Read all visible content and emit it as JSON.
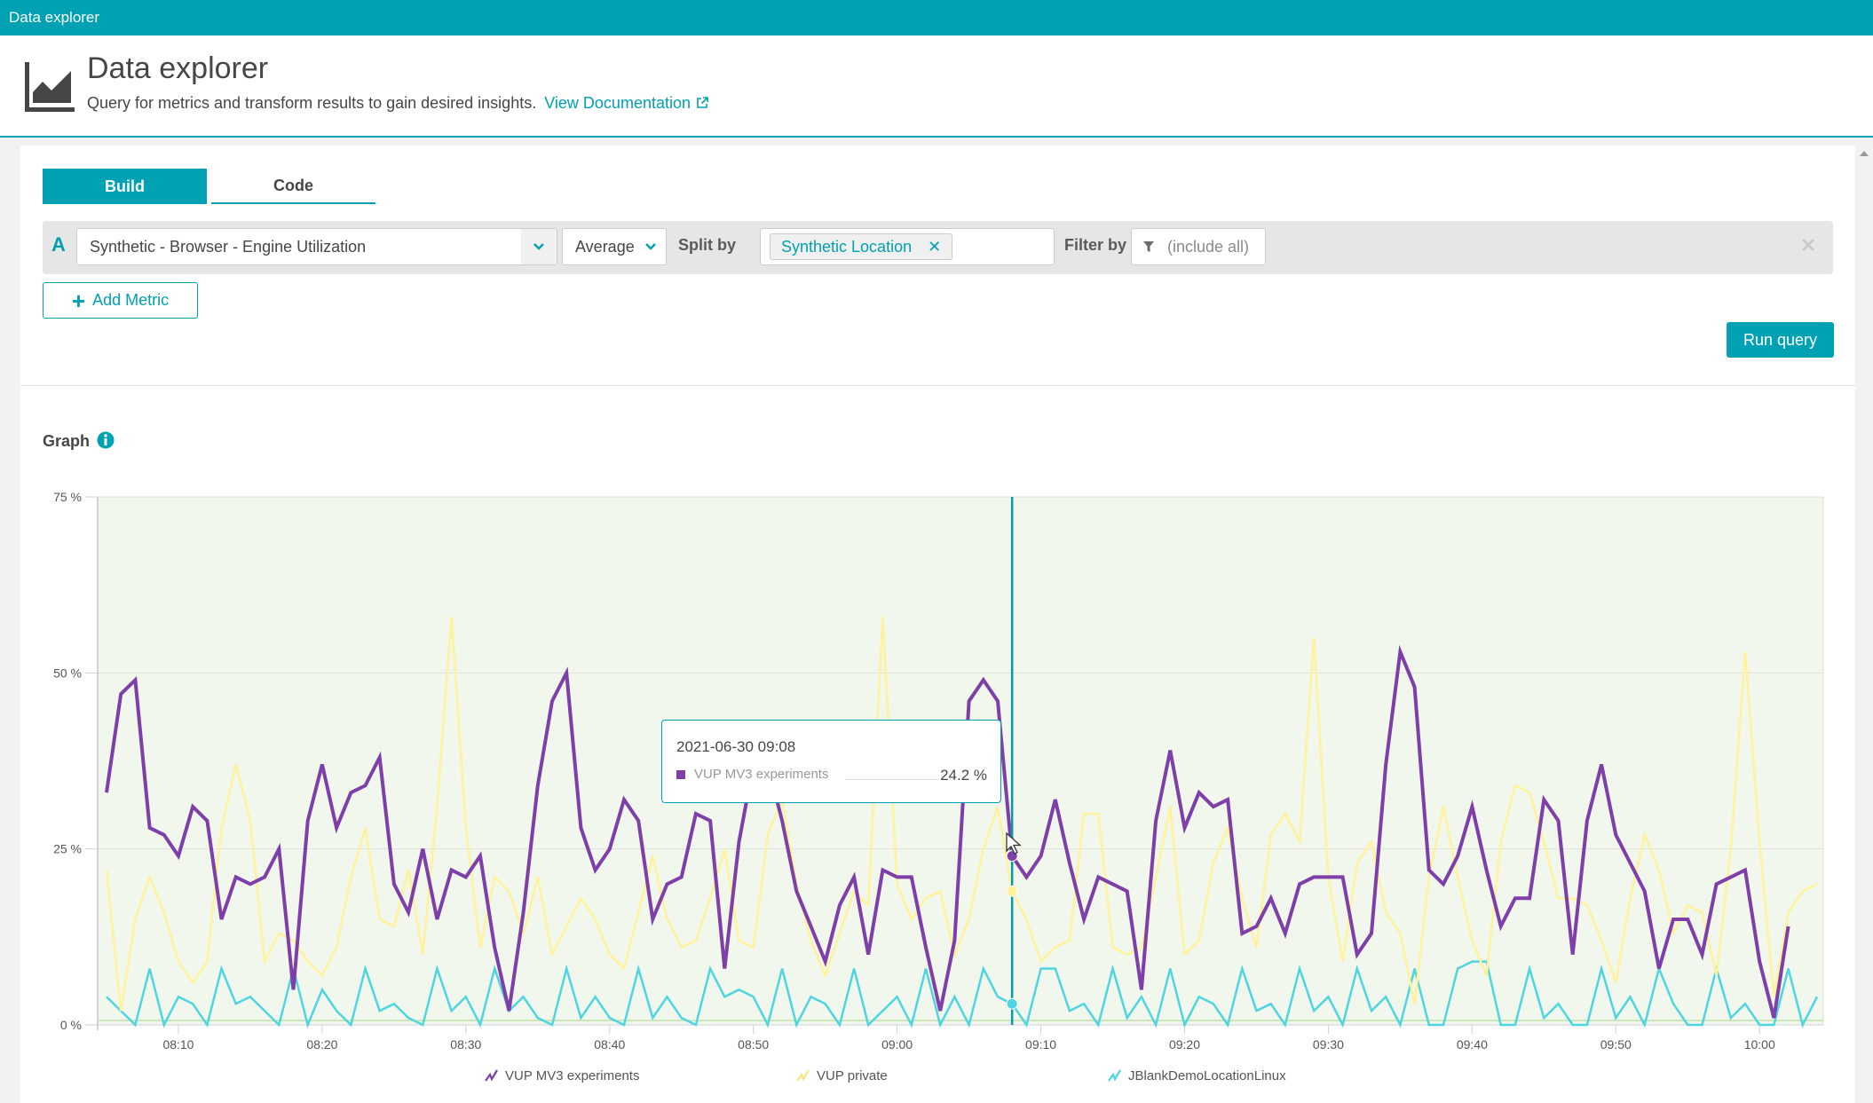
{
  "topbar": {
    "title": "Data explorer"
  },
  "header": {
    "title": "Data explorer",
    "subtitle": "Query for metrics and transform results to gain desired insights.",
    "doc_link": "View Documentation"
  },
  "tabs": [
    {
      "label": "Build",
      "active": true
    },
    {
      "label": "Code",
      "active": false
    }
  ],
  "query": {
    "letter": "A",
    "metric": "Synthetic - Browser - Engine Utilization",
    "aggregation": "Average",
    "split_by_label": "Split by",
    "split_by_chip": "Synthetic Location",
    "filter_by_label": "Filter by",
    "filter_placeholder": "(include all)"
  },
  "buttons": {
    "add_metric": "Add Metric",
    "run_query": "Run query"
  },
  "graph": {
    "title": "Graph"
  },
  "tooltip": {
    "date": "2021-06-30 09:08",
    "series": "VUP MV3 experiments",
    "value": "24.2 %",
    "color": "#7e3fa8"
  },
  "colors": {
    "accent": "#00a1b2",
    "plot_bg": "#f1f7ec",
    "crosshair": "#0899a8"
  },
  "chart_data": {
    "type": "line",
    "title": "Graph",
    "xlabel": "",
    "ylabel": "",
    "y_unit": "%",
    "ylim": [
      0,
      75
    ],
    "yticks": [
      0,
      25,
      50,
      75
    ],
    "ytick_labels": [
      "0 %",
      "25 %",
      "50 %",
      "75 %"
    ],
    "x_start": "08:05",
    "x_end": "10:04",
    "x_step_minutes": 1,
    "xtick_labels": [
      "08:10",
      "08:20",
      "08:30",
      "08:40",
      "08:50",
      "09:00",
      "09:10",
      "09:20",
      "09:30",
      "09:40",
      "09:50",
      "10:00"
    ],
    "xtick_minutes_from_start": [
      5,
      15,
      25,
      35,
      45,
      55,
      65,
      75,
      85,
      95,
      105,
      115
    ],
    "crosshair_minute_from_start": 63,
    "grid": true,
    "legend_position": "bottom",
    "series": [
      {
        "name": "VUP MV3 experiments",
        "color": "#7e3fa8",
        "values": [
          33,
          47,
          49,
          28,
          27,
          24,
          31,
          29,
          15,
          21,
          20,
          21,
          25,
          5,
          29,
          37,
          28,
          33,
          34,
          38,
          20,
          16,
          25,
          15,
          22,
          21,
          24,
          11,
          2,
          16,
          34,
          46,
          50,
          28,
          22,
          25,
          32,
          29,
          15,
          20,
          21,
          30,
          29,
          8,
          26,
          37,
          37,
          29,
          19,
          14,
          9,
          17,
          21,
          10,
          22,
          21,
          21,
          11,
          2,
          12,
          46,
          49,
          46,
          24,
          21,
          24,
          32,
          23,
          15,
          21,
          20,
          19,
          5,
          29,
          39,
          28,
          33,
          31,
          32,
          13,
          14,
          18,
          13,
          20,
          21,
          21,
          21,
          10,
          13,
          37,
          53,
          48,
          22,
          20,
          24,
          31,
          22,
          14,
          18,
          18,
          32,
          29,
          10,
          29,
          37,
          27,
          23,
          19,
          8,
          15,
          15,
          10,
          20,
          21,
          22,
          9,
          1,
          14
        ]
      },
      {
        "name": "VUP private",
        "color": "#fff29a",
        "values": [
          22,
          2,
          15,
          21,
          16,
          9,
          6,
          9,
          28,
          37,
          29,
          9,
          13,
          12,
          9,
          7,
          11,
          21,
          28,
          15,
          14,
          22,
          10,
          31,
          58,
          28,
          11,
          21,
          19,
          13,
          21,
          10,
          14,
          18,
          15,
          10,
          8,
          16,
          24,
          15,
          11,
          12,
          18,
          25,
          12,
          11,
          27,
          32,
          20,
          12,
          7,
          13,
          19,
          17,
          58,
          20,
          15,
          18,
          19,
          10,
          15,
          25,
          31,
          19,
          15,
          9,
          11,
          12,
          30,
          30,
          11,
          10,
          11,
          21,
          31,
          10,
          12,
          23,
          28,
          18,
          11,
          27,
          30,
          26,
          55,
          21,
          9,
          23,
          26,
          16,
          13,
          3,
          21,
          31,
          21,
          12,
          7,
          26,
          34,
          33,
          26,
          18,
          18,
          17,
          12,
          6,
          18,
          27,
          22,
          13,
          17,
          16,
          7,
          25,
          53,
          26,
          4,
          16,
          19,
          20
        ]
      },
      {
        "name": "JBlankDemoLocationLinux",
        "color": "#4fd5e0",
        "values": [
          4,
          2,
          0,
          8,
          0,
          4,
          3,
          0,
          8,
          3,
          4,
          2,
          0,
          8,
          0,
          5,
          2,
          0,
          8,
          2,
          3,
          1,
          0,
          8,
          2,
          4,
          0,
          8,
          2,
          4,
          1,
          0,
          8,
          1,
          4,
          1,
          0,
          8,
          1,
          4,
          1,
          0,
          8,
          4,
          5,
          4,
          0,
          8,
          0,
          4,
          3,
          0,
          8,
          0,
          2,
          4,
          0,
          8,
          0,
          4,
          0,
          8,
          4,
          3,
          0,
          8,
          8,
          2,
          3,
          0,
          8,
          1,
          4,
          0,
          8,
          0,
          4,
          3,
          0,
          8,
          2,
          3,
          0,
          8,
          2,
          4,
          0,
          8,
          2,
          4,
          0,
          8,
          0,
          0,
          8,
          9,
          9,
          0,
          0,
          8,
          1,
          3,
          0,
          0,
          8,
          1,
          4,
          0,
          8,
          3,
          0,
          0,
          8,
          1,
          3,
          0,
          0,
          8,
          0,
          4
        ]
      }
    ]
  }
}
